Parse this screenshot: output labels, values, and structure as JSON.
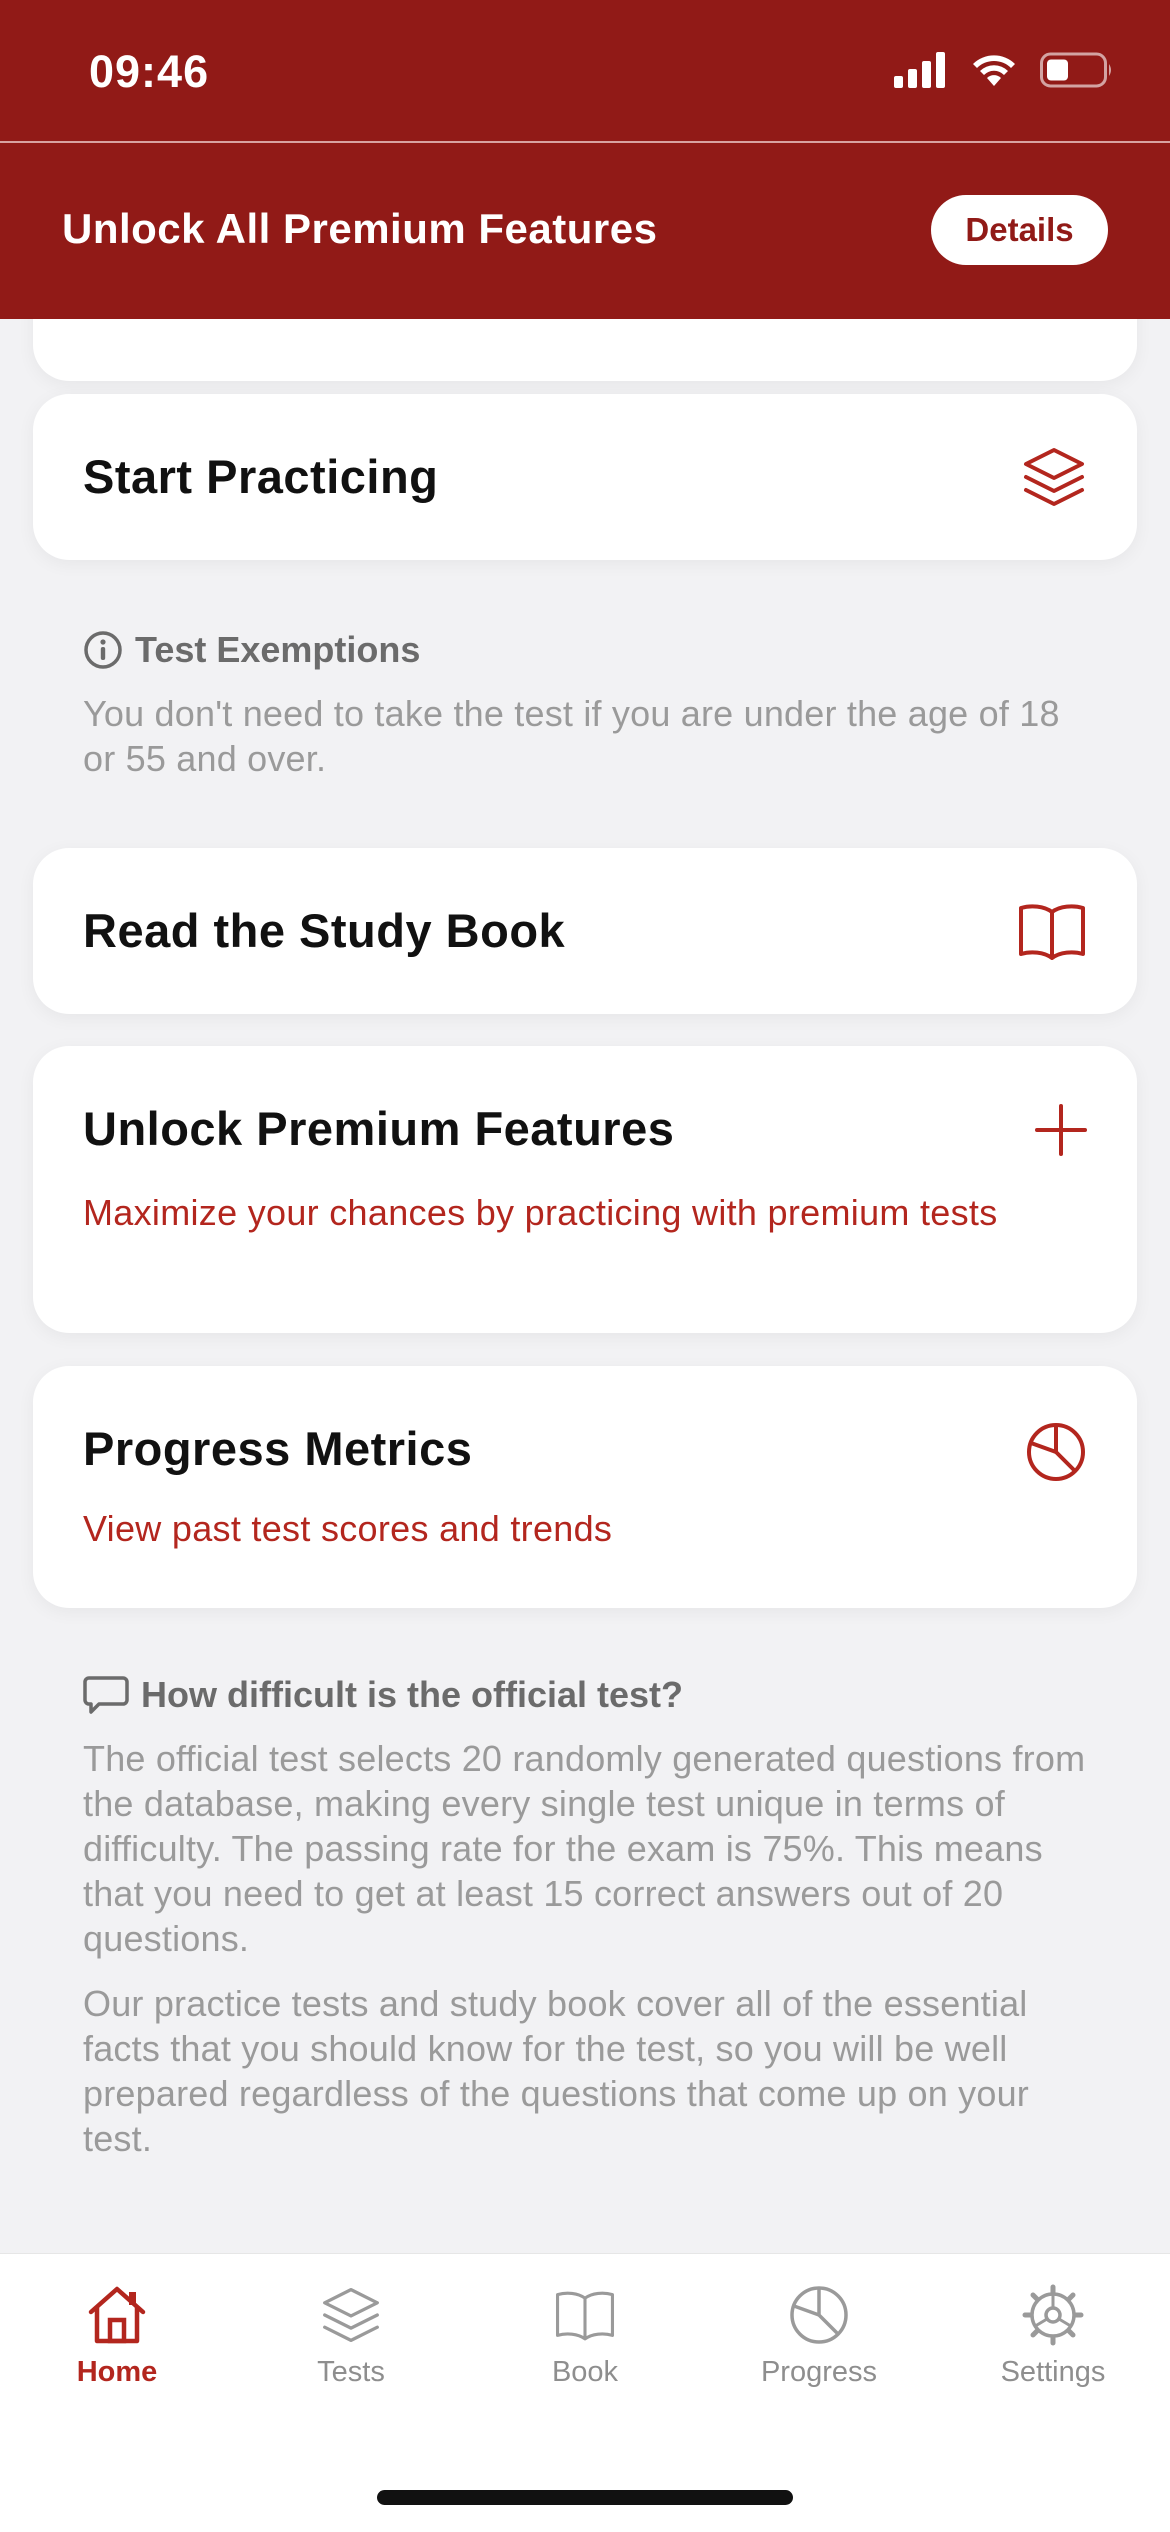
{
  "status_bar": {
    "time": "09:46"
  },
  "header": {
    "title": "Unlock All Premium Features",
    "details_label": "Details"
  },
  "cards": {
    "start_practicing": {
      "title": "Start Practicing",
      "icon": "layers-icon"
    },
    "study_book": {
      "title": "Read the Study Book",
      "icon": "book-icon"
    },
    "premium": {
      "title": "Unlock Premium Features",
      "subtitle": "Maximize your chances by practicing with premium tests",
      "icon": "plus-icon"
    },
    "progress": {
      "title": "Progress Metrics",
      "subtitle": "View past test scores and trends",
      "icon": "pie-chart-icon"
    }
  },
  "exemptions": {
    "heading": "Test Exemptions",
    "text": "You don't need to take the test if you are under the age of 18 or 55 and over."
  },
  "difficulty": {
    "heading": "How difficult is the official test?",
    "paragraph1": "The official test selects 20 randomly generated questions from the database, making every single test unique in terms of difficulty. The passing rate for the exam is 75%. This means that you need to get at least 15 correct answers out of 20 questions.",
    "paragraph2": "Our practice tests and study book cover all of the essential facts that you should know for the test, so you will be well prepared regardless of the questions that come up on your test."
  },
  "tabbar": {
    "items": [
      {
        "label": "Home",
        "icon": "home-icon",
        "active": true
      },
      {
        "label": "Tests",
        "icon": "layers-icon",
        "active": false
      },
      {
        "label": "Book",
        "icon": "book-icon",
        "active": false
      },
      {
        "label": "Progress",
        "icon": "pie-chart-icon",
        "active": false
      },
      {
        "label": "Settings",
        "icon": "gear-icon",
        "active": false
      }
    ]
  },
  "colors": {
    "brand": "#911a17",
    "accent": "#b3261e",
    "muted_text": "#9a9a9a"
  }
}
